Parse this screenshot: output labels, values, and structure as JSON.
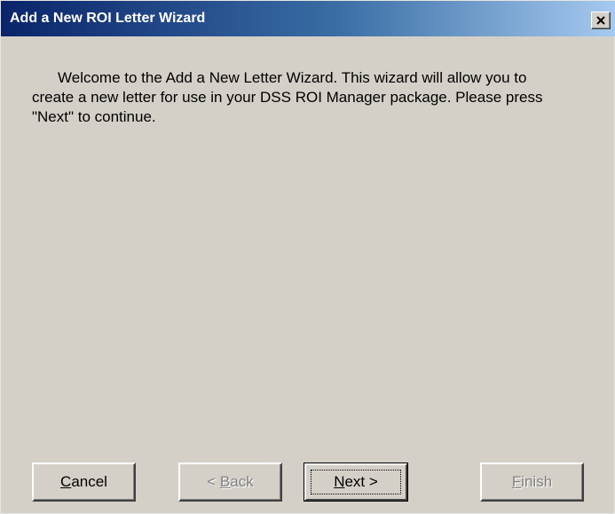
{
  "window": {
    "title": "Add a New ROI Letter Wizard",
    "close_glyph": "×"
  },
  "content": {
    "intro": "Welcome to the Add a New Letter Wizard.  This wizard will allow you to create a new letter for use in your DSS ROI Manager package.  Please press \"Next\" to continue."
  },
  "buttons": {
    "cancel": {
      "accel": "C",
      "rest": "ancel",
      "enabled": true
    },
    "back": {
      "pre": "< ",
      "accel": "B",
      "rest": "ack",
      "enabled": false
    },
    "next": {
      "accel": "N",
      "rest": "ext >",
      "enabled": true,
      "default": true
    },
    "finish": {
      "accel": "F",
      "rest": "inish",
      "enabled": false
    }
  }
}
